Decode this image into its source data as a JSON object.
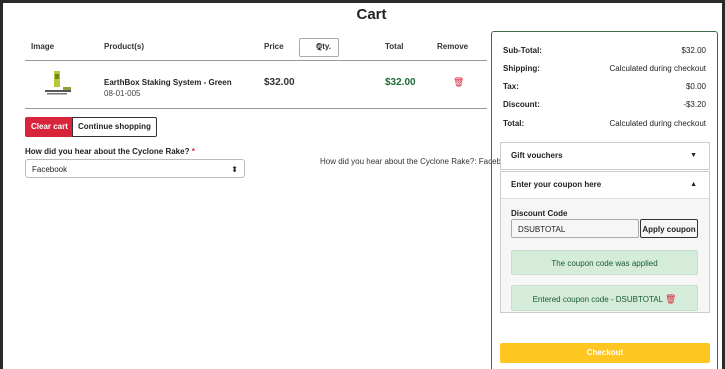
{
  "page": {
    "title": "Cart"
  },
  "table": {
    "headers": [
      "Image",
      "Product(s)",
      "Price",
      "Qty.",
      "Total",
      "Remove"
    ],
    "item": {
      "name": "EarthBox Staking System - Green",
      "sku": "08-01-005",
      "price": "$32.00",
      "qty": "1",
      "total": "$32.00"
    }
  },
  "actions": {
    "clear": "Clear cart",
    "continue": "Continue shopping"
  },
  "survey": {
    "label": "How did you hear about the Cyclone Rake?",
    "required_mark": "*",
    "selected": "Facebook",
    "summary": "How did you hear about the Cyclone Rake?: Facebook"
  },
  "summary": {
    "rows": [
      {
        "k": "Sub-Total:",
        "v": "$32.00"
      },
      {
        "k": "Shipping:",
        "v": "Calculated during checkout"
      },
      {
        "k": "Tax:",
        "v": "$0.00"
      },
      {
        "k": "Discount:",
        "v": "-$3.20"
      },
      {
        "k": "Total:",
        "v": "Calculated during checkout"
      }
    ],
    "gift": "Gift vouchers",
    "coupon_header": "Enter your coupon here",
    "discount_label": "Discount Code",
    "code_value": "DSUBTOTAL",
    "apply": "Apply coupon",
    "applied_msg": "The coupon code was applied",
    "entered_msg": "Entered coupon code - DSUBTOTAL",
    "checkout": "Checkout"
  },
  "colors": {
    "red": "#d9253b",
    "green": "#1a6b3a",
    "yellow": "#ffc520"
  }
}
